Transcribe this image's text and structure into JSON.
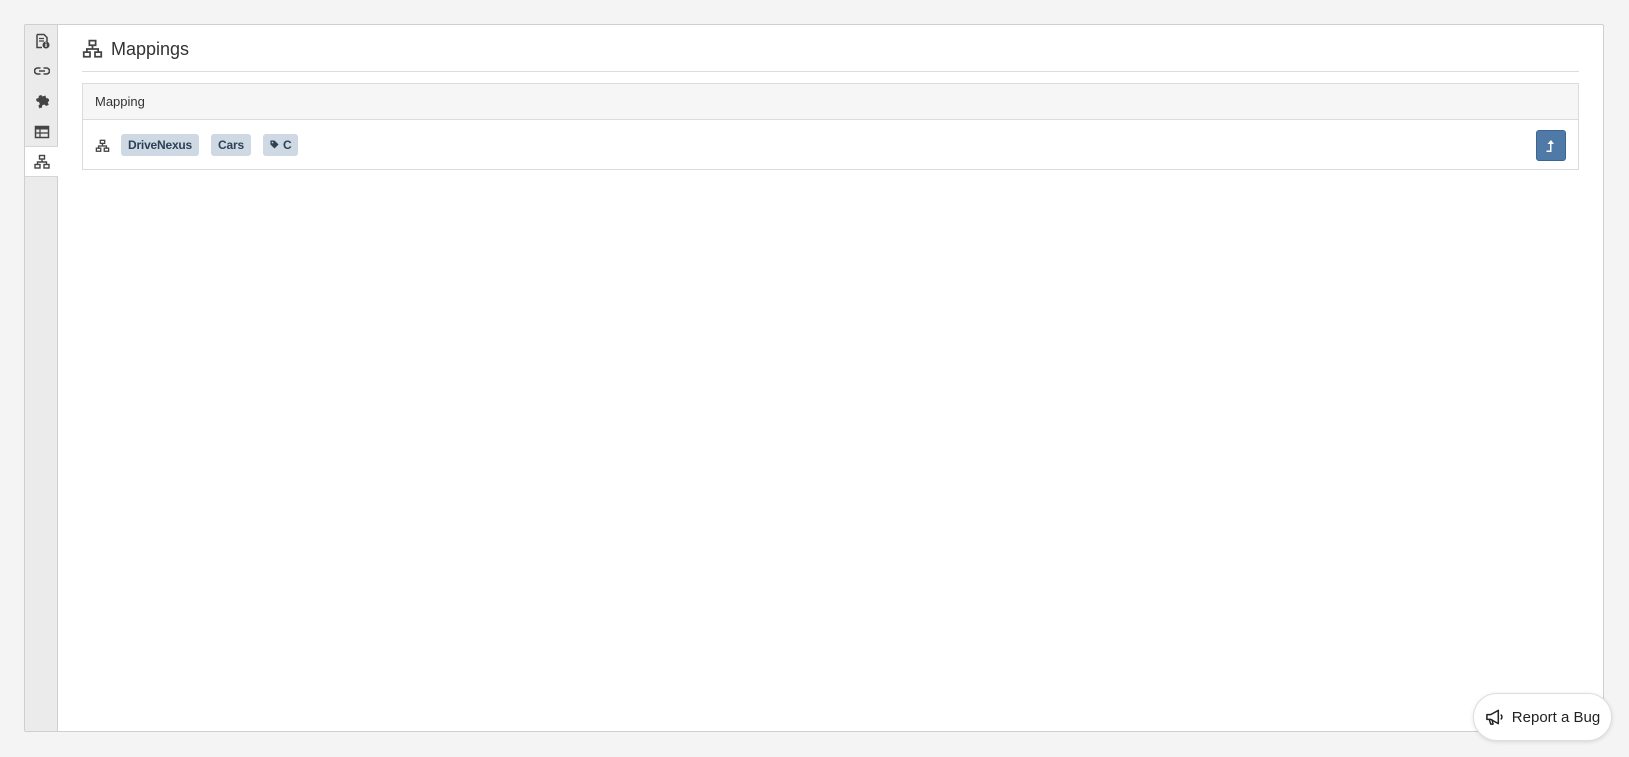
{
  "sidebar": {
    "items": [
      {
        "id": "details",
        "icon": "document-info-icon"
      },
      {
        "id": "links",
        "icon": "link-icon"
      },
      {
        "id": "plugins",
        "icon": "puzzle-icon"
      },
      {
        "id": "tables",
        "icon": "table-icon"
      },
      {
        "id": "mappings",
        "icon": "sitemap-icon",
        "active": true
      }
    ]
  },
  "header": {
    "title": "Mappings",
    "icon": "sitemap-icon"
  },
  "mappings_table": {
    "columns": [
      "Mapping"
    ],
    "rows": [
      {
        "icon": "sitemap-icon",
        "badges": [
          {
            "label": "DriveNexus"
          },
          {
            "label": "Cars"
          },
          {
            "label": "C",
            "icon": "tag-icon"
          }
        ],
        "action_icon": "level-up-icon"
      }
    ]
  },
  "report_bug": {
    "label": "Report a Bug",
    "icon": "megaphone-icon"
  },
  "colors": {
    "badge_bg": "#cfd9e3",
    "badge_text": "#2b4257",
    "action_button": "#4f7aa8",
    "rail_bg": "#ebebeb"
  }
}
